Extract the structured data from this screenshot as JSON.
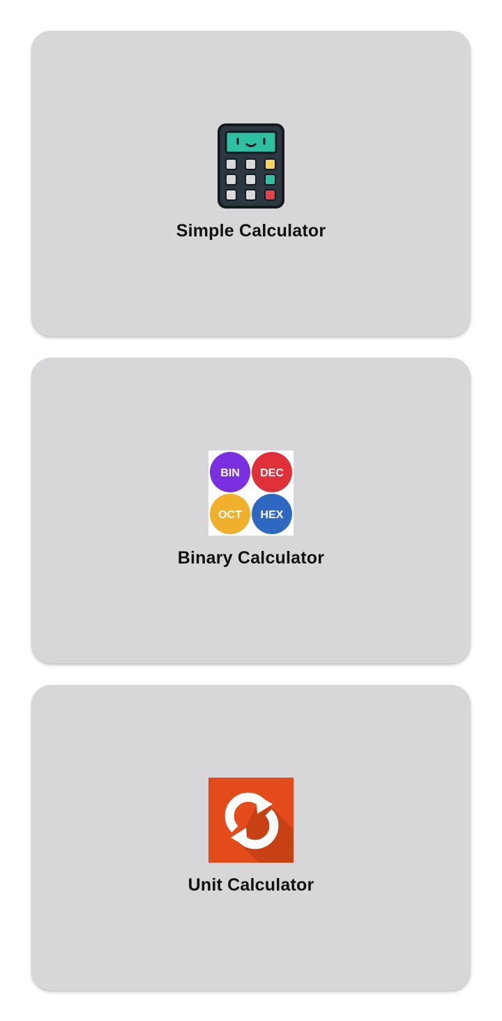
{
  "cards": [
    {
      "label": "Simple Calculator",
      "icon": "calculator-icon"
    },
    {
      "label": "Binary Calculator",
      "icon": "number-systems-icon",
      "badges": [
        "BIN",
        "DEC",
        "OCT",
        "HEX"
      ],
      "badge_colors": [
        "#7a2fe0",
        "#e0303a",
        "#f0b02c",
        "#2f68c0"
      ]
    },
    {
      "label": "Unit Calculator",
      "icon": "unit-convert-icon",
      "bg_color": "#e34b1a"
    }
  ],
  "colors": {
    "card_bg": "#d7d7d9",
    "page_bg": "#ffffff",
    "text": "#111111"
  }
}
